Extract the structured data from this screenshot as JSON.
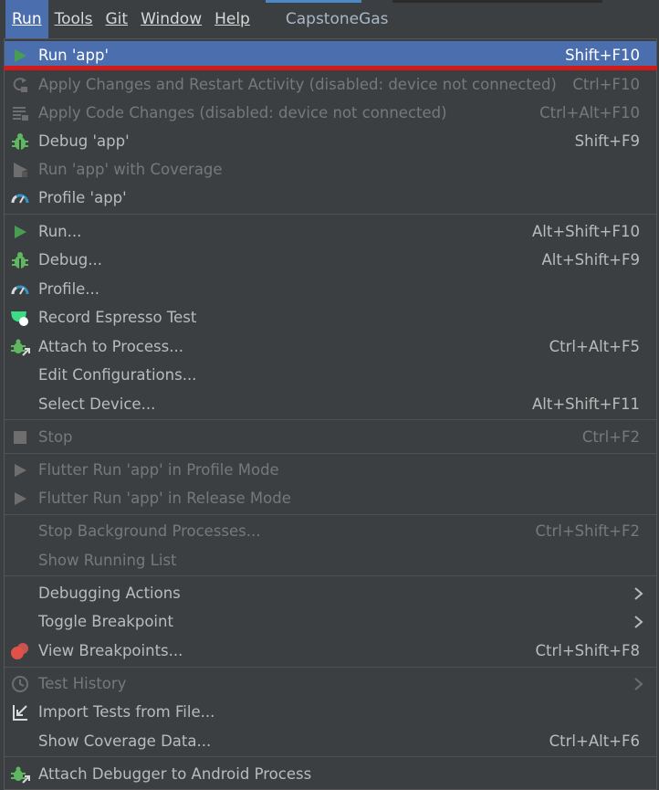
{
  "menubar": {
    "items": [
      {
        "label": "Run"
      },
      {
        "label": "Tools"
      },
      {
        "label": "Git"
      },
      {
        "label": "Window"
      },
      {
        "label": "Help"
      }
    ],
    "project": "CapstoneGas"
  },
  "menu": {
    "items": [
      {
        "label": "Run 'app'",
        "shortcut": "Shift+F10",
        "icon": "run-icon",
        "state": "selected"
      },
      {
        "label": "Apply Changes and Restart Activity (disabled: device not connected)",
        "shortcut": "Ctrl+F10",
        "icon": "apply-changes-icon",
        "state": "disabled"
      },
      {
        "label": "Apply Code Changes (disabled: device not connected)",
        "shortcut": "Ctrl+Alt+F10",
        "icon": "apply-code-changes-icon",
        "state": "disabled"
      },
      {
        "label": "Debug 'app'",
        "shortcut": "Shift+F9",
        "icon": "debug-icon",
        "state": "enabled"
      },
      {
        "label": "Run 'app' with Coverage",
        "shortcut": "",
        "icon": "coverage-icon",
        "state": "disabled"
      },
      {
        "label": "Profile 'app'",
        "shortcut": "",
        "icon": "profile-icon",
        "state": "enabled"
      },
      {
        "label": "Run...",
        "shortcut": "Alt+Shift+F10",
        "icon": "run-icon",
        "state": "enabled"
      },
      {
        "label": "Debug...",
        "shortcut": "Alt+Shift+F9",
        "icon": "debug-icon",
        "state": "enabled"
      },
      {
        "label": "Profile...",
        "shortcut": "",
        "icon": "profile-icon",
        "state": "enabled"
      },
      {
        "label": "Record Espresso Test",
        "shortcut": "",
        "icon": "record-espresso-icon",
        "state": "enabled"
      },
      {
        "label": "Attach to Process...",
        "shortcut": "Ctrl+Alt+F5",
        "icon": "attach-process-icon",
        "state": "enabled"
      },
      {
        "label": "Edit Configurations...",
        "shortcut": "",
        "icon": "",
        "state": "enabled"
      },
      {
        "label": "Select Device...",
        "shortcut": "Alt+Shift+F11",
        "icon": "",
        "state": "enabled"
      },
      {
        "label": "Stop",
        "shortcut": "Ctrl+F2",
        "icon": "stop-icon",
        "state": "disabled"
      },
      {
        "label": "Flutter Run 'app' in Profile Mode",
        "shortcut": "",
        "icon": "run-icon",
        "state": "disabled"
      },
      {
        "label": "Flutter Run 'app' in Release Mode",
        "shortcut": "",
        "icon": "run-icon",
        "state": "disabled"
      },
      {
        "label": "Stop Background Processes...",
        "shortcut": "Ctrl+Shift+F2",
        "icon": "",
        "state": "disabled"
      },
      {
        "label": "Show Running List",
        "shortcut": "",
        "icon": "",
        "state": "disabled"
      },
      {
        "label": "Debugging Actions",
        "shortcut": "",
        "icon": "",
        "state": "enabled",
        "submenu": true
      },
      {
        "label": "Toggle Breakpoint",
        "shortcut": "",
        "icon": "",
        "state": "enabled",
        "submenu": true
      },
      {
        "label": "View Breakpoints...",
        "shortcut": "Ctrl+Shift+F8",
        "icon": "breakpoints-icon",
        "state": "enabled"
      },
      {
        "label": "Test History",
        "shortcut": "",
        "icon": "clock-icon",
        "state": "disabled",
        "submenu": true
      },
      {
        "label": "Import Tests from File...",
        "shortcut": "",
        "icon": "import-tests-icon",
        "state": "enabled"
      },
      {
        "label": "Show Coverage Data...",
        "shortcut": "Ctrl+Alt+F6",
        "icon": "",
        "state": "enabled"
      },
      {
        "label": "Attach Debugger to Android Process",
        "shortcut": "",
        "icon": "attach-debugger-icon",
        "state": "enabled"
      }
    ]
  },
  "colors": {
    "menu_background": "#3c3f41",
    "selection": "#4b6eaf",
    "enabled_text": "#bbbbbb",
    "disabled_text": "#787878",
    "run_green": "#499c54",
    "debug_green": "#5fb85f",
    "annotation_red": "#d31a1a"
  }
}
